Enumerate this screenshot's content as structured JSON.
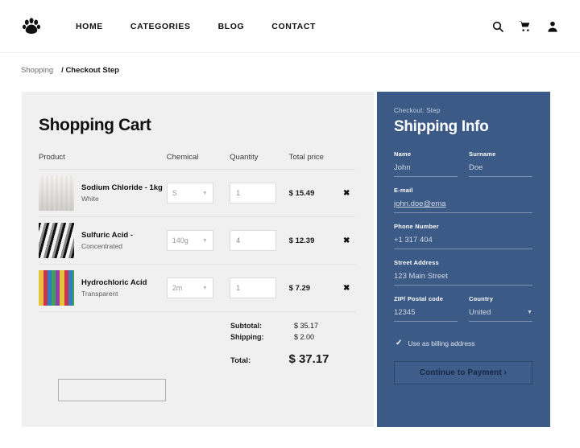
{
  "header": {
    "logo_icon": "paw-icon",
    "nav": [
      {
        "label": "HOME"
      },
      {
        "label": "CATEGORIES"
      },
      {
        "label": "BLOG"
      },
      {
        "label": "CONTACT"
      }
    ],
    "icons": [
      {
        "name": "search-icon"
      },
      {
        "name": "cart-icon"
      },
      {
        "name": "user-icon"
      }
    ]
  },
  "breadcrumb": {
    "root": "Shopping",
    "separator": "/",
    "current": "Checkout Step"
  },
  "cart": {
    "title": "Shopping Cart",
    "columns": {
      "product": "Product",
      "chemical": "Chemical",
      "quantity": "Quantity",
      "total_price": "Total price"
    },
    "items": [
      {
        "name": "Sodium Chloride - 1kg",
        "variant": "White",
        "chemical": "S",
        "quantity": "1",
        "total": "$ 15.49",
        "remove": "✖",
        "thumb": "lab-bench-photo"
      },
      {
        "name": "Sulfuric Acid -",
        "variant": "Concentrated",
        "chemical": "140g",
        "quantity": "4",
        "total": "$ 12.39",
        "remove": "✖",
        "thumb": "industrial-pipes-photo"
      },
      {
        "name": "Hydrochloric Acid",
        "variant": "Transparent",
        "chemical": "2m",
        "quantity": "1",
        "total": "$ 7.29",
        "remove": "✖",
        "thumb": "colored-bottles-photo"
      }
    ],
    "totals": {
      "subtotal_label": "Subtotal:",
      "subtotal_value": "$ 35.17",
      "shipping_label": "Shipping:",
      "shipping_value": "$ 2.00",
      "total_label": "Total:",
      "total_value": "$ 37.17"
    },
    "coupon_value": ""
  },
  "shipping": {
    "step": "Checkout: Step",
    "title": "Shipping Info",
    "fields": {
      "name_label": "Name",
      "name_value": "John",
      "surname_label": "Surname",
      "surname_value": "Doe",
      "email_label": "E-mail",
      "email_value": "john.doe@ema",
      "phone_label": "Phone Number",
      "phone_value": "+1 317 404",
      "street_label": "Street Address",
      "street_value": "123 Main Street",
      "zip_label": "ZIP/ Postal code",
      "zip_value": "12345",
      "country_label": "Country",
      "country_value": "United"
    },
    "billing_checkbox_label": "Use as billing address",
    "billing_checked": "✓",
    "submit_label": "Continue to Payment ›"
  },
  "colors": {
    "panel_blue": "#3c5a86",
    "cart_gray": "#f0f0f0",
    "text_dark": "#111111"
  }
}
